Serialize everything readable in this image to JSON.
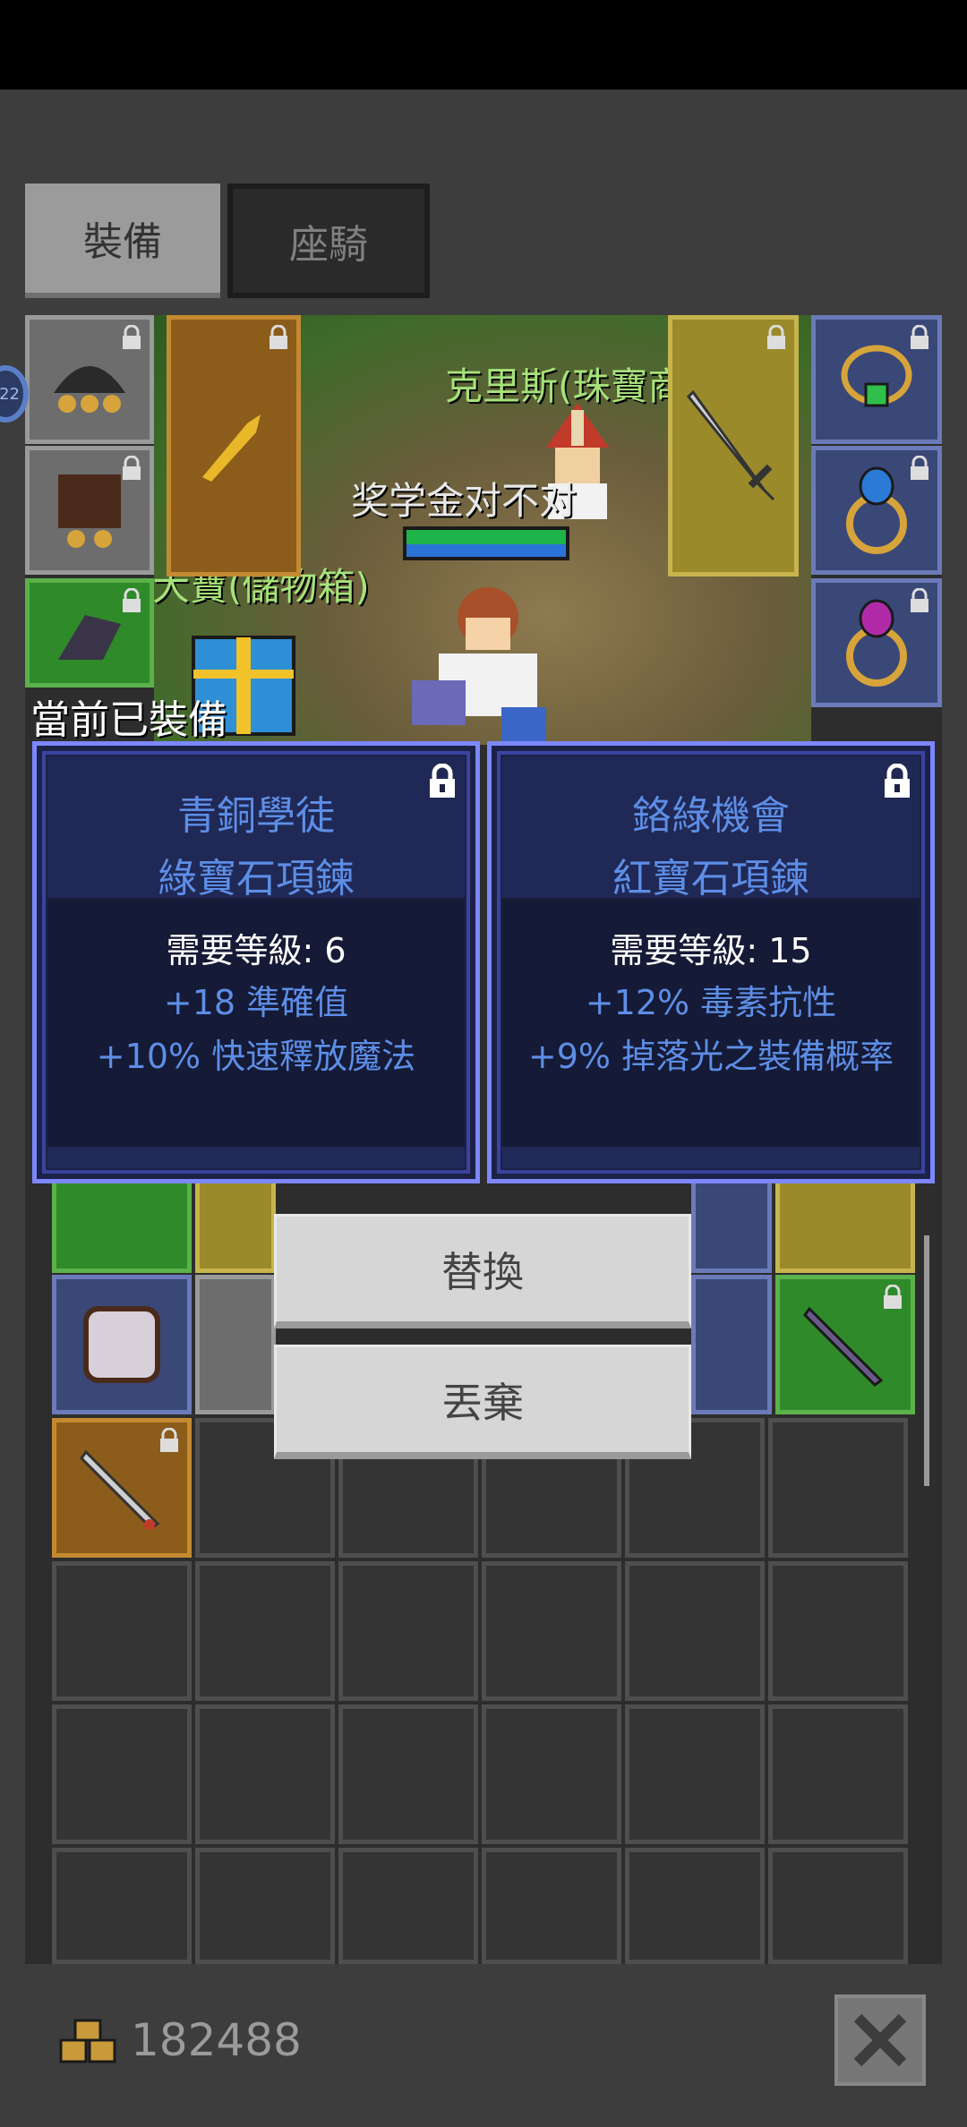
{
  "tabs": [
    {
      "label": "裝備",
      "active": true
    },
    {
      "label": "座騎",
      "active": false
    }
  ],
  "scene": {
    "npc_name": "克里斯(珠寶商)",
    "player_name": "奖学金对不对",
    "chest_label": "大寶(儲物箱)"
  },
  "current_equipped_label": "當前已裝備",
  "compare_cards": [
    {
      "title_line1": "青銅學徒",
      "title_line2": "綠寶石項鍊",
      "level": "需要等級: 6",
      "stat1": "+18 準確值",
      "stat2": "+10% 快速釋放魔法"
    },
    {
      "title_line1": "鉻綠機會",
      "title_line2": "紅寶石項鍊",
      "level": "需要等級: 15",
      "stat1": "+12% 毒素抗性",
      "stat2": "+9% 掉落光之裝備概率"
    }
  ],
  "actions": {
    "replace_label": "替換",
    "discard_label": "丟棄"
  },
  "badge": "22",
  "gold": {
    "amount": "182488",
    "icon": "gold-coins-icon"
  },
  "colors": {
    "card_border": "#7d87ff",
    "card_title": "#5d8ee6",
    "stat_text": "#5d8ee6",
    "npc_name": "#a6e27a"
  }
}
